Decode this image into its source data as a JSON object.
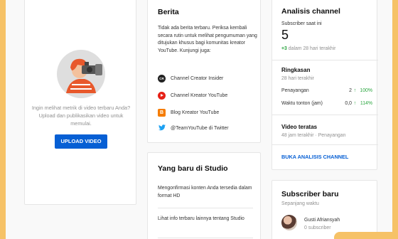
{
  "upload_card": {
    "prompt": "Ingin melihat metrik di video terbaru Anda? Upload dan publikasikan video untuk memulai.",
    "button_label": "UPLOAD VIDEO"
  },
  "news": {
    "title": "Berita",
    "description": "Tidak ada berita terbaru. Periksa kembali secara rutin untuk melihat pengumuman yang ditujukan khusus bagi komunitas kreator YouTube. Kunjungi juga:",
    "links": [
      {
        "label": "Channel Creator Insider",
        "icon": "creator-insider-icon"
      },
      {
        "label": "Channel Kreator YouTube",
        "icon": "youtube-icon"
      },
      {
        "label": "Blog Kreator YouTube",
        "icon": "blogger-icon"
      },
      {
        "label": "@TeamYouTube di Twitter",
        "icon": "twitter-icon"
      }
    ]
  },
  "studio": {
    "title": "Yang baru di Studio",
    "items": [
      "Mengonfirmasi konten Anda tersedia dalam format HD",
      "Lihat info terbaru lainnya tentang Studio"
    ]
  },
  "analytics": {
    "title": "Analisis channel",
    "subs_label": "Subscriber saat ini",
    "subs_count": "5",
    "subs_change_value": "+3",
    "subs_change_text": "dalam 28 hari terakhir",
    "summary_title": "Ringkasan",
    "summary_period": "28 hari terakhir",
    "metrics": [
      {
        "label": "Penayangan",
        "value": "2",
        "pct": "100%"
      },
      {
        "label": "Waktu tonton (jam)",
        "value": "0,0",
        "pct": "114%"
      }
    ],
    "top_videos_title": "Video teratas",
    "top_videos_sub": "48 jam terakhir · Penayangan",
    "link_label": "BUKA ANALISIS CHANNEL"
  },
  "recent_subs": {
    "title": "Subscriber baru",
    "period": "Sepanjang waktu",
    "subscriber_name": "Gusti Afriansyah",
    "subscriber_count": "0 subscriber"
  },
  "colors": {
    "accent": "#065fd4",
    "positive": "#2ba640",
    "side_band": "#f6c267"
  }
}
